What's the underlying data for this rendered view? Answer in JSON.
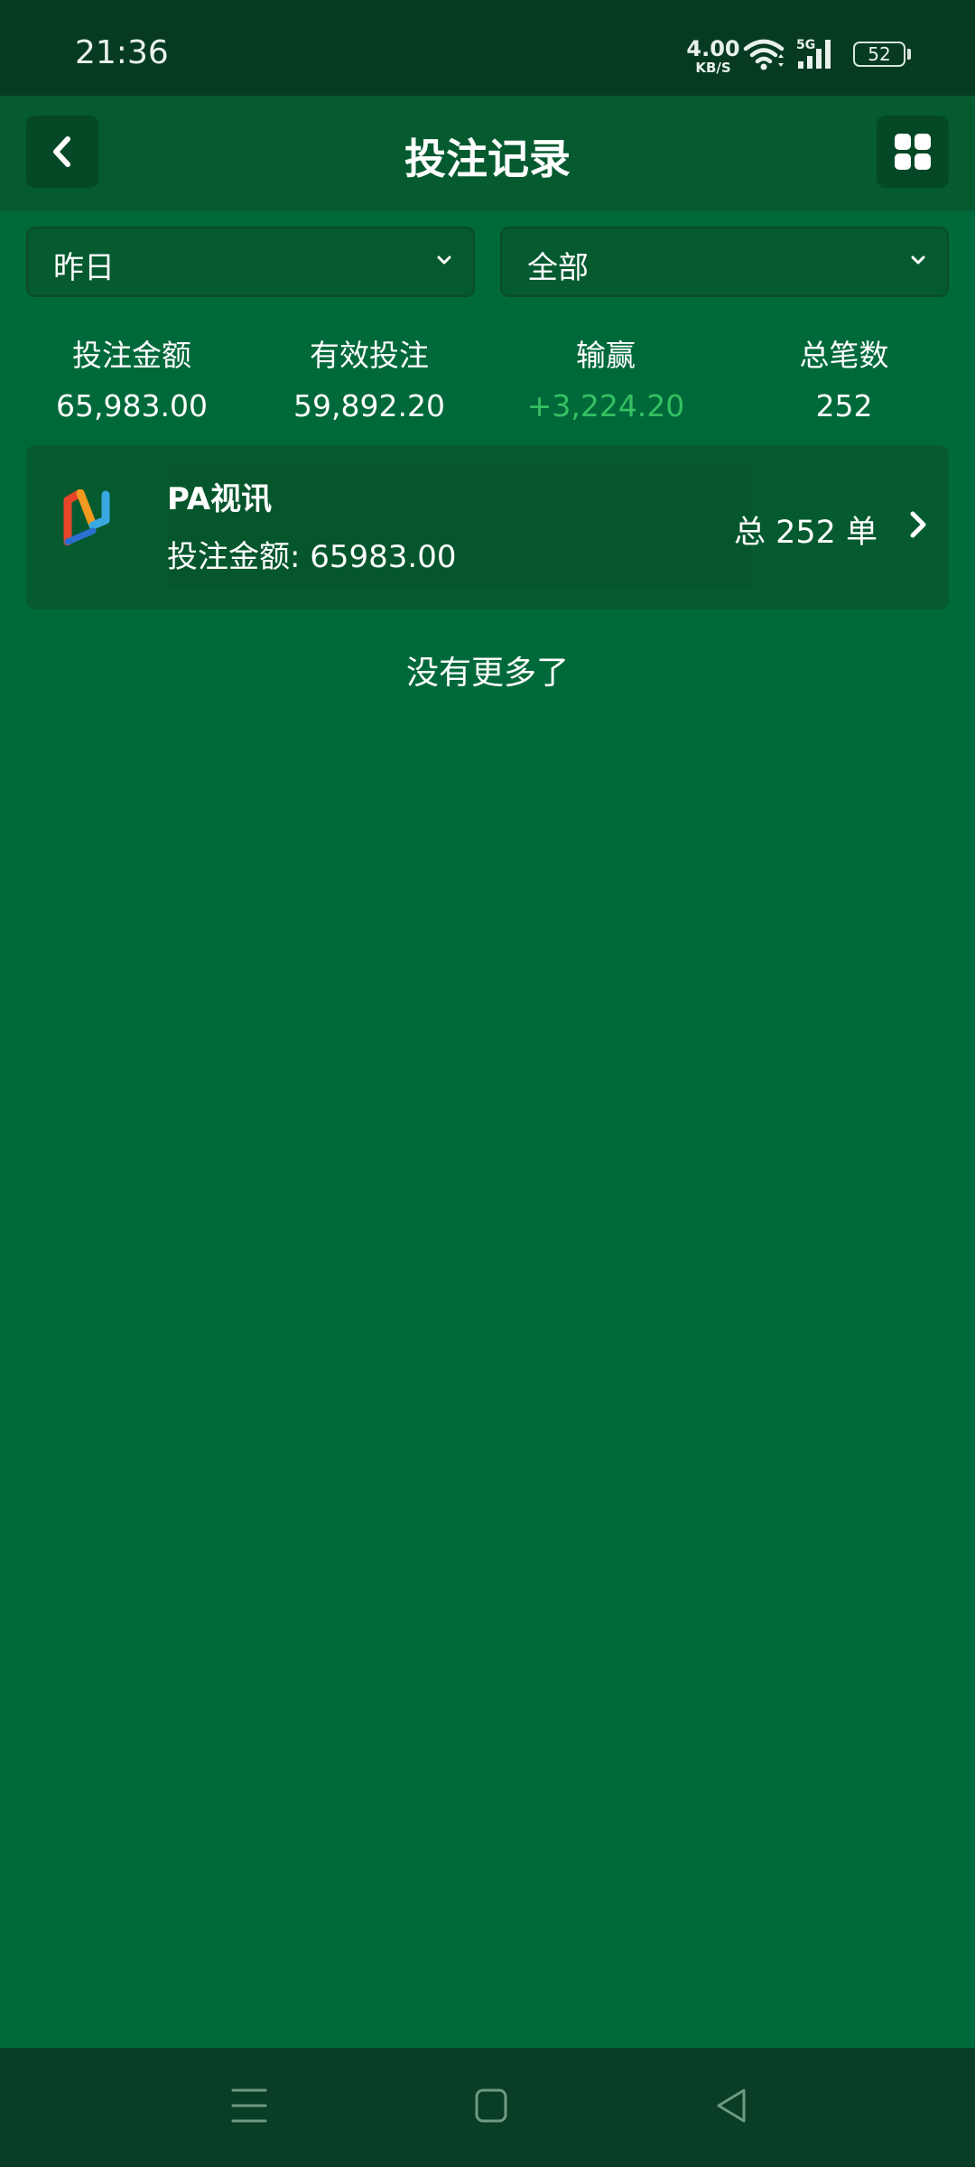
{
  "status_bar": {
    "time": "21:36",
    "net_speed": "4.00",
    "net_unit": "KB/S",
    "network_type": "5G",
    "battery": "52"
  },
  "header": {
    "title": "投注记录",
    "back_icon": "chevron-left-icon",
    "menu_icon": "grid-icon"
  },
  "filters": {
    "date": "昨日",
    "type": "全部",
    "dropdown_icon": "chevron-down-icon"
  },
  "stats": [
    {
      "label": "投注金额",
      "value": "65,983.00"
    },
    {
      "label": "有效投注",
      "value": "59,892.20"
    },
    {
      "label": "输赢",
      "value": "+3,224.20"
    },
    {
      "label": "总笔数",
      "value": "252"
    }
  ],
  "provider": {
    "name": "PA视讯",
    "amount": "投注金额: 65983.00",
    "total": "总 252 单",
    "logo_icon": "provider-logo-icon"
  },
  "list_end": "没有更多了",
  "colors": {
    "background": "#00693a",
    "status_bar": "#063b22",
    "header": "#055a30",
    "positive": "#35c062",
    "system_nav": "#093d25"
  }
}
